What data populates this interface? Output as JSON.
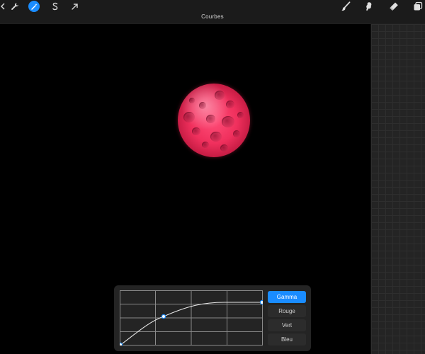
{
  "toolbar": {
    "left_icons": [
      {
        "name": "gallery-icon",
        "glyph": "◂"
      },
      {
        "name": "actions-wrench-icon",
        "glyph": "wrench"
      },
      {
        "name": "adjustments-magic-wand-icon",
        "glyph": "wand",
        "active": true
      },
      {
        "name": "selection-icon",
        "glyph": "S"
      },
      {
        "name": "transform-arrow-icon",
        "glyph": "arrow"
      }
    ],
    "mode_title": "Courbes",
    "right_icons": [
      "brush-icon",
      "smudge-icon",
      "eraser-icon",
      "layers-icon"
    ]
  },
  "colors": {
    "accent": "#1a8cff",
    "canvas": "#000000",
    "planet": "#f0305d"
  },
  "curves_panel": {
    "channels": [
      {
        "label": "Gamma",
        "active": true
      },
      {
        "label": "Rouge",
        "active": false
      },
      {
        "label": "Vert",
        "active": false
      },
      {
        "label": "Bleu",
        "active": false
      }
    ]
  }
}
